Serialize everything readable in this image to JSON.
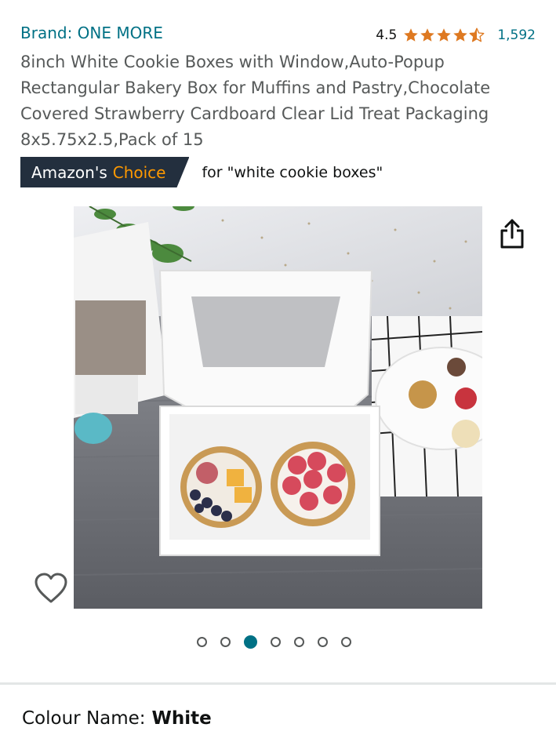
{
  "product": {
    "brand": "Brand: ONE MORE",
    "rating": "4.5",
    "stars_filled": 4.5,
    "review_count": "1,592",
    "title": "8inch White Cookie Boxes with Window,Auto-Popup Rectangular Bakery Box for Muffins and Pastry,Chocolate Covered Strawberry Cardboard Clear Lid Treat Packaging 8x5.75x2.5,Pack of 15"
  },
  "badge": {
    "prefix": "Amazon's",
    "choice": "Choice",
    "for_text": "for \"white cookie boxes\""
  },
  "gallery": {
    "image_count": 7,
    "active_index": 3
  },
  "variation": {
    "label": "Colour Name:",
    "value": "White"
  },
  "colors": {
    "link": "#007185",
    "star": "#de7921",
    "badge_bg": "#232f3e",
    "badge_accent": "#ff9900"
  },
  "icons": {
    "share": "share-icon",
    "wishlist": "heart-icon"
  }
}
